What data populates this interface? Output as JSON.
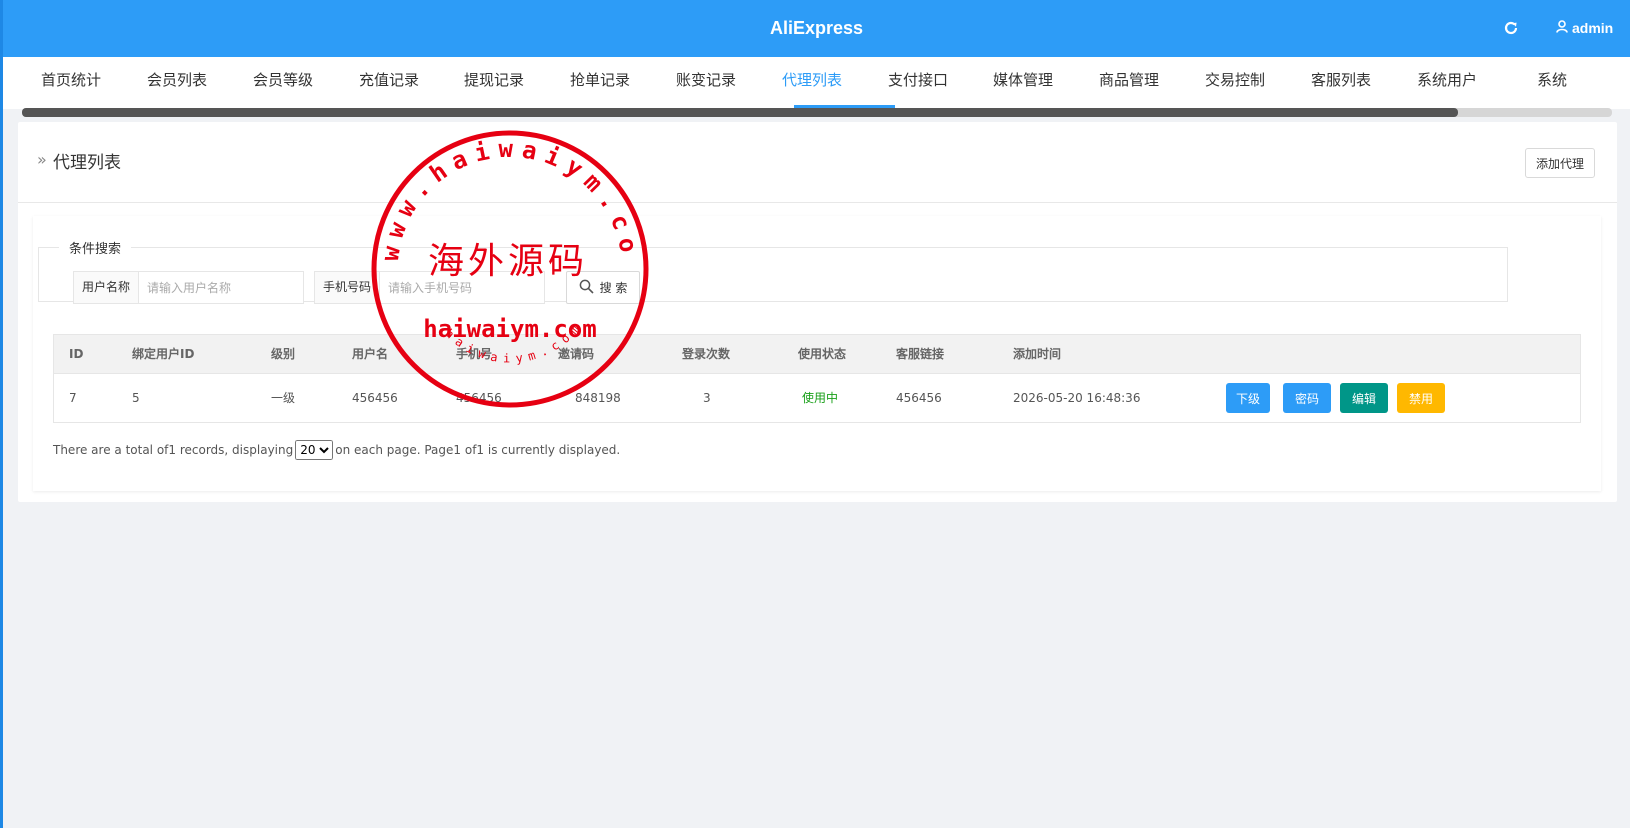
{
  "header": {
    "title": "AliExpress",
    "user": "admin",
    "refresh_icon": "refresh-icon",
    "user_icon": "user-icon"
  },
  "nav": {
    "items": [
      "首页统计",
      "会员列表",
      "会员等级",
      "充值记录",
      "提现记录",
      "抢单记录",
      "账变记录",
      "代理列表",
      "支付接口",
      "媒体管理",
      "商品管理",
      "交易控制",
      "客服列表",
      "系统用户",
      "系统"
    ],
    "active_index": 7,
    "scroll_position": 0.9
  },
  "page": {
    "title": "代理列表",
    "add_button": "添加代理"
  },
  "search": {
    "legend": "条件搜索",
    "username_label": "用户名称",
    "username_placeholder": "请输入用户名称",
    "phone_label": "手机号码",
    "phone_placeholder": "请输入手机号码",
    "search_button": "搜 索"
  },
  "table": {
    "columns": [
      "ID",
      "绑定用户ID",
      "级别",
      "用户名",
      "手机号",
      "邀请码",
      "登录次数",
      "使用状态",
      "客服链接",
      "添加时间"
    ],
    "rows": [
      {
        "id": "7",
        "bind_user_id": "5",
        "level": "一级",
        "username": "456456",
        "phone": "456456",
        "invite_code": "848198",
        "login_count": "3",
        "status": "使用中",
        "service_link": "456456",
        "created": "2026-05-20 16:48:36",
        "actions": [
          "下级",
          "密码",
          "编辑",
          "禁用"
        ]
      }
    ]
  },
  "pager": {
    "prefix": "There are a total of1 records, displaying",
    "page_size": "20",
    "suffix": "on each page. Page1 of1 is currently displayed."
  },
  "stamp": {
    "outer_text": "www.haiwaiym.com",
    "center_text": "海外源码",
    "mid_text": "haiwaiym.com",
    "inner_text": "haiwaiym.com",
    "color": "#e60012"
  },
  "colors": {
    "primary": "#2d9cf7",
    "teal": "#009688",
    "warn": "#ffb800",
    "status_ok": "#1aa01a"
  }
}
